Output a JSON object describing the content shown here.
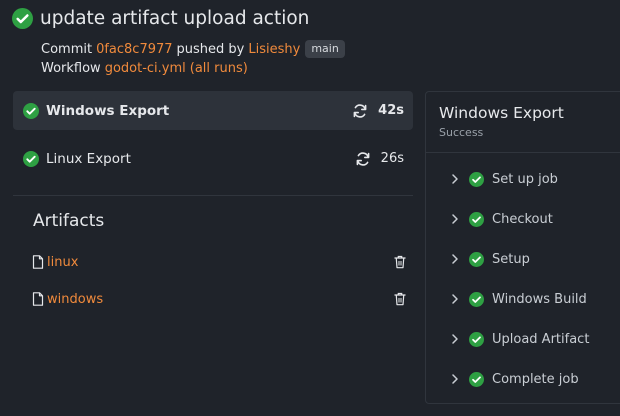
{
  "run": {
    "title": "update artifact upload action",
    "commit_label": "Commit",
    "commit_sha": "0fac8c7977",
    "pushed_by_label": "pushed by",
    "author": "Lisieshy",
    "branch": "main",
    "workflow_label": "Workflow",
    "workflow_file": "godot-ci.yml",
    "all_runs_label": "all runs"
  },
  "jobs": [
    {
      "name": "Windows Export",
      "duration": "42s",
      "status": "success",
      "selected": true
    },
    {
      "name": "Linux Export",
      "duration": "26s",
      "status": "success",
      "selected": false
    }
  ],
  "artifacts": {
    "title": "Artifacts",
    "items": [
      {
        "name": "linux"
      },
      {
        "name": "windows"
      }
    ]
  },
  "job_detail": {
    "title": "Windows Export",
    "status": "Success",
    "steps": [
      {
        "label": "Set up job"
      },
      {
        "label": "Checkout"
      },
      {
        "label": "Setup"
      },
      {
        "label": "Windows Build"
      },
      {
        "label": "Upload Artifact"
      },
      {
        "label": "Complete job"
      }
    ]
  },
  "colors": {
    "background": "#1f232a",
    "success": "#2ea043",
    "link": "#f08a3c",
    "selected_row": "#2d323a"
  }
}
